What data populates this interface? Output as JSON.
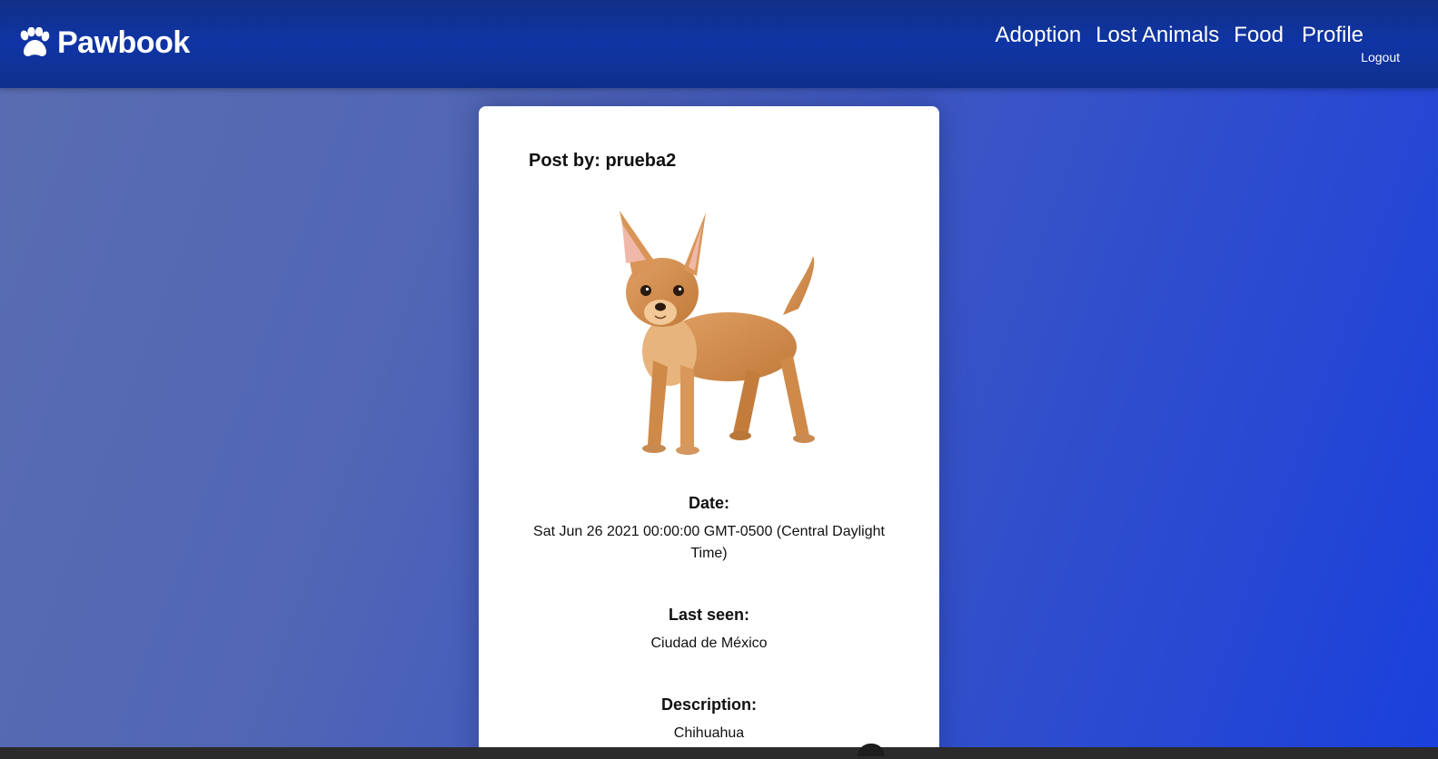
{
  "brand": {
    "name": "Pawbook",
    "icon": "paw-icon"
  },
  "nav": {
    "links": [
      {
        "label": "Adoption"
      },
      {
        "label": "Lost Animals"
      },
      {
        "label": "Food"
      },
      {
        "label": "Profile"
      }
    ],
    "logout": "Logout"
  },
  "post": {
    "author_line": "Post by: prueba2",
    "image": "chihuahua-dog-photo",
    "date_label": "Date:",
    "date_value": "Sat Jun 26 2021 00:00:00 GMT-0500 (Central Daylight Time)",
    "last_seen_label": "Last seen:",
    "last_seen_value": "Ciudad de México",
    "description_label": "Description:",
    "description_value": "Chihuahua"
  },
  "colors": {
    "navbar": "#0f35a5",
    "background_start": "#5a6db2",
    "background_end": "#1a40dc",
    "card": "#ffffff"
  }
}
